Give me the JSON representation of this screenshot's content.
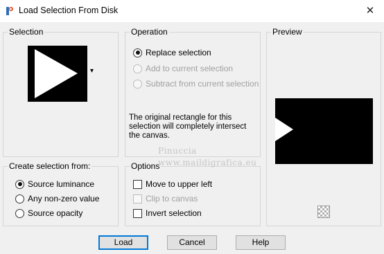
{
  "window": {
    "title": "Load Selection From Disk",
    "close_glyph": "✕"
  },
  "selection": {
    "label": "Selection",
    "dropdown_glyph": "▾"
  },
  "operation": {
    "label": "Operation",
    "options": [
      {
        "label": "Replace selection",
        "checked": true,
        "enabled": true
      },
      {
        "label": "Add to current selection",
        "checked": false,
        "enabled": false
      },
      {
        "label": "Subtract from current selection",
        "checked": false,
        "enabled": false
      }
    ],
    "info_text": "The original rectangle for this selection will completely intersect the canvas."
  },
  "preview": {
    "label": "Preview",
    "checker_icon": "transparency-checker-icon"
  },
  "create_from": {
    "label": "Create selection from:",
    "options": [
      {
        "label": "Source luminance",
        "checked": true
      },
      {
        "label": "Any non-zero value",
        "checked": false
      },
      {
        "label": "Source opacity",
        "checked": false
      }
    ]
  },
  "options": {
    "label": "Options",
    "checks": [
      {
        "label": "Move to upper left",
        "checked": false,
        "enabled": true
      },
      {
        "label": "Clip to canvas",
        "checked": false,
        "enabled": false
      },
      {
        "label": "Invert selection",
        "checked": false,
        "enabled": true
      }
    ]
  },
  "buttons": {
    "load": "Load",
    "cancel": "Cancel",
    "help": "Help"
  },
  "watermark": {
    "line1": "Pinuccia",
    "line2": "www.maildigrafica.eu"
  }
}
